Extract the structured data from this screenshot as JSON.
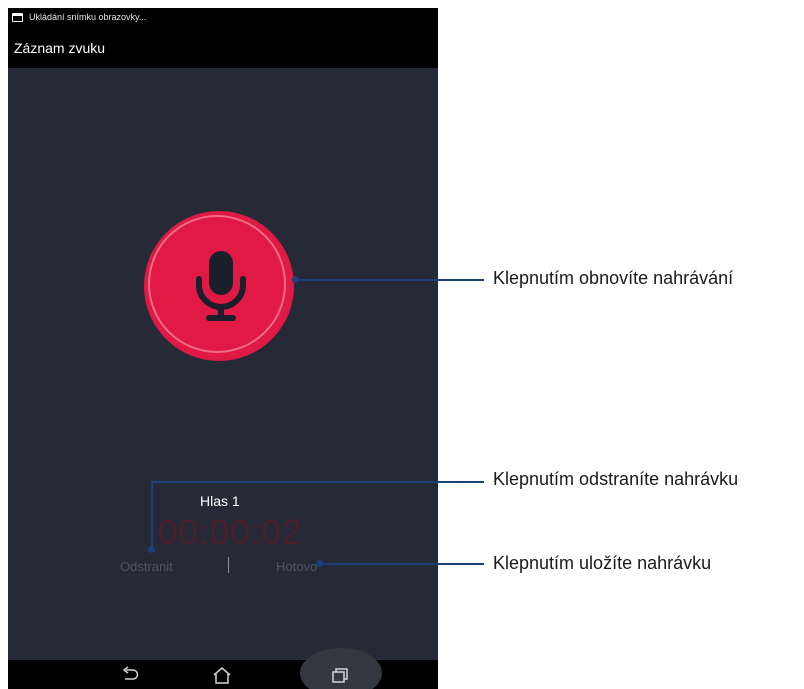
{
  "status_bar": {
    "notification_text": "Ukládání snímku obrazovky..."
  },
  "app": {
    "title": "Záznam zvuku"
  },
  "recorder": {
    "record_button_color": "#e01a44",
    "voice_name": "Hlas 1",
    "timer": "00:00:02",
    "delete_label": "Odstranit",
    "divider": "|",
    "done_label": "Hotovo"
  },
  "nav_bar": {
    "icons": [
      "back-icon",
      "home-icon",
      "recent-apps-icon"
    ]
  },
  "callouts": [
    {
      "text": "Klepnutím obnovíte nahrávání"
    },
    {
      "text": "Klepnutím odstraníte nahrávku"
    },
    {
      "text": "Klepnutím uložíte nahrávku"
    }
  ],
  "colors": {
    "accent": "#e01a44",
    "background": "#252a36",
    "callout": "#1b3f79"
  }
}
